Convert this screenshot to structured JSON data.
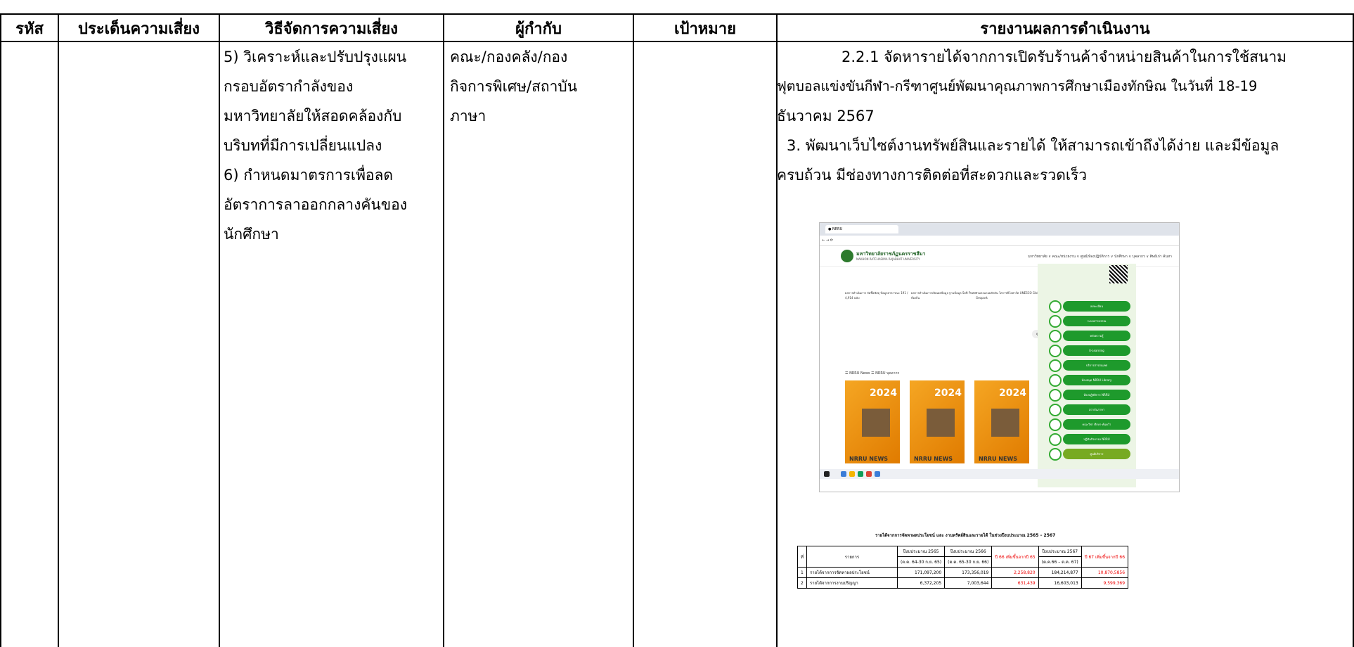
{
  "headers": {
    "code": "รหัส",
    "risk_issue": "ประเด็นความเสี่ยง",
    "risk_method": "วิธีจัดการความเสี่ยง",
    "supervisor": "ผู้กำกับ",
    "target": "เป้าหมาย",
    "report": "รายงานผลการดำเนินงาน"
  },
  "methods": [
    "5) วิเคราะห์และปรับปรุงแผน",
    "กรอบอัตรากำลังของ",
    "มหาวิทยาลัยให้สอดคล้องกับ",
    "บริบทที่มีการเปลี่ยนแปลง",
    "6) กำหนดมาตรการเพื่อลด",
    "อัตราการลาออกกลางคันของ",
    "นักศึกษา"
  ],
  "supervisors": [
    "คณะ/กองคลัง/กอง",
    "กิจการพิเศษ/สถาบัน",
    "ภาษา"
  ],
  "report_lines": [
    "2.2.1  จัดหารายได้จากการเปิดรับร้านค้าจำหน่ายสินค้าในการใช้สนาม",
    "ฟุตบอลแข่งขันกีฬา-กรีฑาศูนย์พัฒนาคุณภาพการศึกษาเมืองทักษิณ ในวันที่ 18-19",
    "ธันวาคม 2567",
    "3.  พัฒนาเว็บไซต์งานทรัพย์สินและรายได้ ให้สามารถเข้าถึงได้ง่าย และมีข้อมูล",
    "ครบถ้วน มีช่องทางการติดต่อที่สะดวกและรวดเร็ว"
  ],
  "screenshot": {
    "site_name": "มหาวิทยาลัยราชภัฏนครราชสีมา",
    "site_sub": "NAKHON RATCHASIMA RAJABHAT UNIVERSITY",
    "menu": "มหาวิทยาลัย ∨   คณะ/หน่วยงาน ∨   ศูนย์/ห้องปฏิบัติการ ∨   นักศึกษา ∨   บุคลากร ∨   ศิษย์เก่า   ค้นหา",
    "news_label": "NEWS",
    "news_texts": [
      "ผลการดำเนินการ จัดซื้อพัสดุ ข้อมูลสาธารณะ 191 / 4,914 ฉบับ",
      "ผลการดำเนินการเปิดเผยข้อมูล ฐานข้อมูล Soft Power ท้องถิ่น",
      "ร่วมลงนามผลักดัน โคราชจีโอพาร์ค UNESCO Global Geopark"
    ],
    "more": "ดูเพิ่มเติม",
    "news_tabs": "☰ NRRU News    ☰ NRRU บุคลากร",
    "poster_year": "2024",
    "poster_name": "NRRU NEWS",
    "sidebar_buttons": [
      "ลงทะเบียน",
      "ระบบสารบรรณ",
      "คลังความรู้",
      "E-Learning",
      "บริการสารสนเทศ",
      "ห้องสมุด NRRU Library",
      "ห้องปฏิบัติการ NRRU",
      "สถาบันภาษา",
      "คณะวิชา ศึกษา-ค้นคว้า",
      "ปฏิทินกิจกรรม NRRU",
      "ศูนย์บริการ"
    ]
  },
  "income_table": {
    "title": "รายได้จากการจัดหาผลประโยชน์ และ งานทรัพย์สินและรายได้ ในช่วงปีงบประมาณ  2565 – 2567",
    "header_row1": [
      "ที่",
      "รายการ",
      "ปีงบประมาณ 2565",
      "ปีงบประมาณ 2566",
      "ปี 66 เพิ่มขึ้นจากปี 65",
      "ปีงบประมาณ 2567",
      "ปี 67 เพิ่มขึ้นจากปี 66"
    ],
    "header_row2": [
      "(ต.ค. 64-30 ก.ย. 65)",
      "(ต.ค. 65-30 ก.ย. 66)",
      "(ต.ค.66 – ต.ค. 67)"
    ],
    "rows": [
      [
        "1",
        "รายได้จากการจัดหาผลประโยชน์",
        "171,097,200",
        "173,356,019",
        "2,258,820",
        "184,214,877",
        "10,870,5856"
      ],
      [
        "2",
        "รายได้จากการงานปริญญา",
        "6,372,205",
        "7,003,644",
        "631,439",
        "16,603,013",
        "9,599,369"
      ]
    ]
  }
}
